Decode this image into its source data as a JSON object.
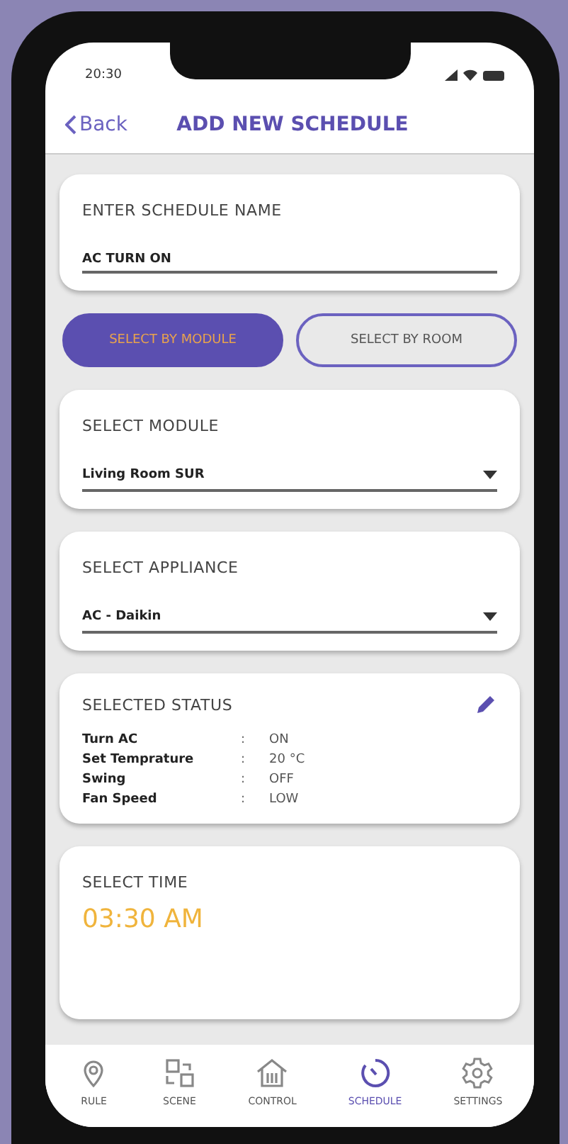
{
  "status_bar": {
    "time": "20:30"
  },
  "header": {
    "back": "Back",
    "title": "ADD NEW SCHEDULE"
  },
  "name_card": {
    "label": "ENTER SCHEDULE NAME",
    "value": "AC TURN ON"
  },
  "mode_buttons": [
    {
      "label": "SELECT BY MODULE",
      "selected": true
    },
    {
      "label": "SELECT BY ROOM",
      "selected": false
    }
  ],
  "dropdowns": [
    {
      "label": "SELECT MODULE",
      "value": "Living Room SUR"
    },
    {
      "label": "SELECT APPLIANCE",
      "value": "AC - Daikin"
    }
  ],
  "status_card": {
    "title": "SELECTED STATUS",
    "rows": [
      {
        "name": "Turn AC",
        "separator": ":",
        "value": "ON"
      },
      {
        "name": "Set Temprature",
        "separator": ":",
        "value": "20 °C"
      },
      {
        "name": "Swing",
        "separator": ":",
        "value": "OFF"
      },
      {
        "name": "Fan Speed",
        "separator": ":",
        "value": "LOW"
      }
    ]
  },
  "time_card": {
    "label": "SELECT TIME",
    "value": "03:30 AM"
  },
  "bottom_nav": [
    {
      "label": "RULE",
      "selected": false
    },
    {
      "label": "SCENE",
      "selected": false
    },
    {
      "label": "CONTROL",
      "selected": false
    },
    {
      "label": "SCHEDULE",
      "selected": true
    },
    {
      "label": "SETTINGS",
      "selected": false
    }
  ]
}
